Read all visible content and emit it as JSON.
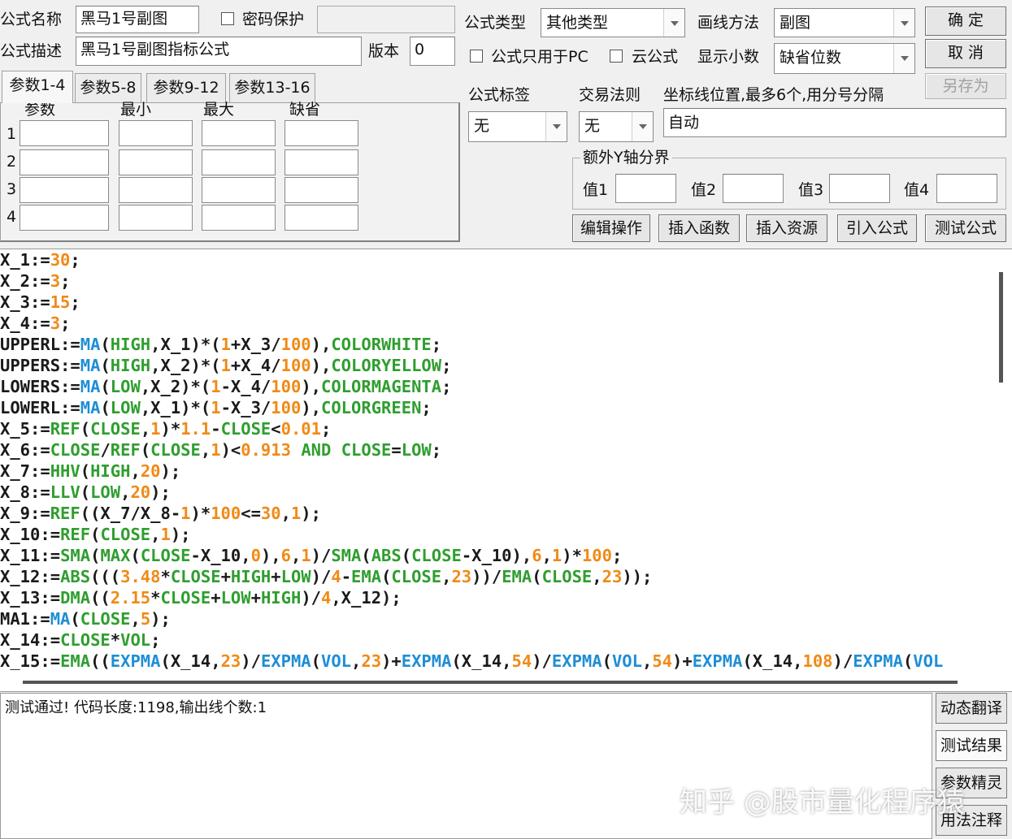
{
  "top": {
    "name_label": "公式名称",
    "name_value": "黑马1号副图",
    "password_label": "密码保护",
    "desc_label": "公式描述",
    "desc_value": "黑马1号副图指标公式",
    "version_label": "版本",
    "version_value": "0",
    "type_label": "公式类型",
    "type_value": "其他类型",
    "draw_label": "画线方法",
    "draw_value": "副图",
    "pc_only_label": "公式只用于PC",
    "cloud_label": "云公式",
    "decimals_label": "显示小数",
    "decimals_value": "缺省位数",
    "ok_button": "确  定",
    "cancel_button": "取  消",
    "save_as_button": "另存为"
  },
  "params": {
    "tabs": [
      "参数1-4",
      "参数5-8",
      "参数9-12",
      "参数13-16"
    ],
    "headers": [
      "参数",
      "最小",
      "最大",
      "缺省"
    ],
    "rows": [
      "1",
      "2",
      "3",
      "4"
    ]
  },
  "options": {
    "tag_label": "公式标签",
    "tag_value": "无",
    "rule_label": "交易法则",
    "rule_value": "无",
    "axis_label": "坐标线位置,最多6个,用分号分隔",
    "axis_value": "自动",
    "extra_y_label": "额外Y轴分界",
    "values": [
      "值1",
      "值2",
      "值3",
      "值4"
    ]
  },
  "actions": [
    "编辑操作",
    "插入函数",
    "插入资源",
    "引入公式",
    "测试公式"
  ],
  "code_lines": [
    [
      [
        "X_1:=",
        "p"
      ],
      [
        "30",
        "n"
      ],
      [
        ";",
        "p"
      ]
    ],
    [
      [
        "X_2:=",
        "p"
      ],
      [
        "3",
        "n"
      ],
      [
        ";",
        "p"
      ]
    ],
    [
      [
        "X_3:=",
        "p"
      ],
      [
        "15",
        "n"
      ],
      [
        ";",
        "p"
      ]
    ],
    [
      [
        "X_4:=",
        "p"
      ],
      [
        "3",
        "n"
      ],
      [
        ";",
        "p"
      ]
    ],
    [
      [
        "UPPERL:=",
        "p"
      ],
      [
        "MA",
        "f"
      ],
      [
        "(",
        "p"
      ],
      [
        "HIGH",
        "k"
      ],
      [
        ",X_1)*(",
        "p"
      ],
      [
        "1",
        "n"
      ],
      [
        "+X_3/",
        "p"
      ],
      [
        "100",
        "n"
      ],
      [
        "),",
        "p"
      ],
      [
        "COLORWHITE",
        "k"
      ],
      [
        ";",
        "p"
      ]
    ],
    [
      [
        "UPPERS:=",
        "p"
      ],
      [
        "MA",
        "f"
      ],
      [
        "(",
        "p"
      ],
      [
        "HIGH",
        "k"
      ],
      [
        ",X_2)*(",
        "p"
      ],
      [
        "1",
        "n"
      ],
      [
        "+X_4/",
        "p"
      ],
      [
        "100",
        "n"
      ],
      [
        "),",
        "p"
      ],
      [
        "COLORYELLOW",
        "k"
      ],
      [
        ";",
        "p"
      ]
    ],
    [
      [
        "LOWERS:=",
        "p"
      ],
      [
        "MA",
        "f"
      ],
      [
        "(",
        "p"
      ],
      [
        "LOW",
        "k"
      ],
      [
        ",X_2)*(",
        "p"
      ],
      [
        "1",
        "n"
      ],
      [
        "-X_4/",
        "p"
      ],
      [
        "100",
        "n"
      ],
      [
        "),",
        "p"
      ],
      [
        "COLORMAGENTA",
        "k"
      ],
      [
        ";",
        "p"
      ]
    ],
    [
      [
        "LOWERL:=",
        "p"
      ],
      [
        "MA",
        "f"
      ],
      [
        "(",
        "p"
      ],
      [
        "LOW",
        "k"
      ],
      [
        ",X_1)*(",
        "p"
      ],
      [
        "1",
        "n"
      ],
      [
        "-X_3/",
        "p"
      ],
      [
        "100",
        "n"
      ],
      [
        "),",
        "p"
      ],
      [
        "COLORGREEN",
        "k"
      ],
      [
        ";",
        "p"
      ]
    ],
    [
      [
        "X_5:=",
        "p"
      ],
      [
        "REF",
        "k"
      ],
      [
        "(",
        "p"
      ],
      [
        "CLOSE",
        "k"
      ],
      [
        ",",
        "p"
      ],
      [
        "1",
        "n"
      ],
      [
        ")*",
        "p"
      ],
      [
        "1.1",
        "n"
      ],
      [
        "-",
        "p"
      ],
      [
        "CLOSE",
        "k"
      ],
      [
        "<",
        "p"
      ],
      [
        "0.01",
        "n"
      ],
      [
        ";",
        "p"
      ]
    ],
    [
      [
        "X_6:=",
        "p"
      ],
      [
        "CLOSE",
        "k"
      ],
      [
        "/",
        "p"
      ],
      [
        "REF",
        "k"
      ],
      [
        "(",
        "p"
      ],
      [
        "CLOSE",
        "k"
      ],
      [
        ",",
        "p"
      ],
      [
        "1",
        "n"
      ],
      [
        ")<",
        "p"
      ],
      [
        "0.913",
        "n"
      ],
      [
        " ",
        "p"
      ],
      [
        "AND",
        "k"
      ],
      [
        " ",
        "p"
      ],
      [
        "CLOSE",
        "k"
      ],
      [
        "=",
        "p"
      ],
      [
        "LOW",
        "k"
      ],
      [
        ";",
        "p"
      ]
    ],
    [
      [
        "X_7:=",
        "p"
      ],
      [
        "HHV",
        "k"
      ],
      [
        "(",
        "p"
      ],
      [
        "HIGH",
        "k"
      ],
      [
        ",",
        "p"
      ],
      [
        "20",
        "n"
      ],
      [
        ");",
        "p"
      ]
    ],
    [
      [
        "X_8:=",
        "p"
      ],
      [
        "LLV",
        "k"
      ],
      [
        "(",
        "p"
      ],
      [
        "LOW",
        "k"
      ],
      [
        ",",
        "p"
      ],
      [
        "20",
        "n"
      ],
      [
        ");",
        "p"
      ]
    ],
    [
      [
        "X_9:=",
        "p"
      ],
      [
        "REF",
        "k"
      ],
      [
        "((X_7/X_8-",
        "p"
      ],
      [
        "1",
        "n"
      ],
      [
        ")*",
        "p"
      ],
      [
        "100",
        "n"
      ],
      [
        "<=",
        "p"
      ],
      [
        "30",
        "n"
      ],
      [
        ",",
        "p"
      ],
      [
        "1",
        "n"
      ],
      [
        ");",
        "p"
      ]
    ],
    [
      [
        "X_10:=",
        "p"
      ],
      [
        "REF",
        "k"
      ],
      [
        "(",
        "p"
      ],
      [
        "CLOSE",
        "k"
      ],
      [
        ",",
        "p"
      ],
      [
        "1",
        "n"
      ],
      [
        ");",
        "p"
      ]
    ],
    [
      [
        "X_11:=",
        "p"
      ],
      [
        "SMA",
        "k"
      ],
      [
        "(",
        "p"
      ],
      [
        "MAX",
        "k"
      ],
      [
        "(",
        "p"
      ],
      [
        "CLOSE",
        "k"
      ],
      [
        "-X_10,",
        "p"
      ],
      [
        "0",
        "n"
      ],
      [
        "),",
        "p"
      ],
      [
        "6",
        "n"
      ],
      [
        ",",
        "p"
      ],
      [
        "1",
        "n"
      ],
      [
        ")/",
        "p"
      ],
      [
        "SMA",
        "k"
      ],
      [
        "(",
        "p"
      ],
      [
        "ABS",
        "k"
      ],
      [
        "(",
        "p"
      ],
      [
        "CLOSE",
        "k"
      ],
      [
        "-X_10),",
        "p"
      ],
      [
        "6",
        "n"
      ],
      [
        ",",
        "p"
      ],
      [
        "1",
        "n"
      ],
      [
        ")*",
        "p"
      ],
      [
        "100",
        "n"
      ],
      [
        ";",
        "p"
      ]
    ],
    [
      [
        "X_12:=",
        "p"
      ],
      [
        "ABS",
        "k"
      ],
      [
        "(((",
        "p"
      ],
      [
        "3.48",
        "n"
      ],
      [
        "*",
        "p"
      ],
      [
        "CLOSE",
        "k"
      ],
      [
        "+",
        "p"
      ],
      [
        "HIGH",
        "k"
      ],
      [
        "+",
        "p"
      ],
      [
        "LOW",
        "k"
      ],
      [
        ")/",
        "p"
      ],
      [
        "4",
        "n"
      ],
      [
        "-",
        "p"
      ],
      [
        "EMA",
        "k"
      ],
      [
        "(",
        "p"
      ],
      [
        "CLOSE",
        "k"
      ],
      [
        ",",
        "p"
      ],
      [
        "23",
        "n"
      ],
      [
        "))/",
        "p"
      ],
      [
        "EMA",
        "k"
      ],
      [
        "(",
        "p"
      ],
      [
        "CLOSE",
        "k"
      ],
      [
        ",",
        "p"
      ],
      [
        "23",
        "n"
      ],
      [
        "));",
        "p"
      ]
    ],
    [
      [
        "X_13:=",
        "p"
      ],
      [
        "DMA",
        "k"
      ],
      [
        "((",
        "p"
      ],
      [
        "2.15",
        "n"
      ],
      [
        "*",
        "p"
      ],
      [
        "CLOSE",
        "k"
      ],
      [
        "+",
        "p"
      ],
      [
        "LOW",
        "k"
      ],
      [
        "+",
        "p"
      ],
      [
        "HIGH",
        "k"
      ],
      [
        ")/",
        "p"
      ],
      [
        "4",
        "n"
      ],
      [
        ",X_12);",
        "p"
      ]
    ],
    [
      [
        "MA1:=",
        "p"
      ],
      [
        "MA",
        "f"
      ],
      [
        "(",
        "p"
      ],
      [
        "CLOSE",
        "k"
      ],
      [
        ",",
        "p"
      ],
      [
        "5",
        "n"
      ],
      [
        ");",
        "p"
      ]
    ],
    [
      [
        "X_14:=",
        "p"
      ],
      [
        "CLOSE",
        "k"
      ],
      [
        "*",
        "p"
      ],
      [
        "VOL",
        "k"
      ],
      [
        ";",
        "p"
      ]
    ],
    [
      [
        "X_15:=",
        "p"
      ],
      [
        "EMA",
        "k"
      ],
      [
        "((",
        "p"
      ],
      [
        "EXPMA",
        "f"
      ],
      [
        "(X_14,",
        "p"
      ],
      [
        "23",
        "n"
      ],
      [
        ")/",
        "p"
      ],
      [
        "EXPMA",
        "f"
      ],
      [
        "(",
        "p"
      ],
      [
        "VOL",
        "f"
      ],
      [
        ",",
        "p"
      ],
      [
        "23",
        "n"
      ],
      [
        ")+",
        "p"
      ],
      [
        "EXPMA",
        "f"
      ],
      [
        "(X_14,",
        "p"
      ],
      [
        "54",
        "n"
      ],
      [
        ")/",
        "p"
      ],
      [
        "EXPMA",
        "f"
      ],
      [
        "(",
        "p"
      ],
      [
        "VOL",
        "f"
      ],
      [
        ",",
        "p"
      ],
      [
        "54",
        "n"
      ],
      [
        ")+",
        "p"
      ],
      [
        "EXPMA",
        "f"
      ],
      [
        "(X_14,",
        "p"
      ],
      [
        "108",
        "n"
      ],
      [
        ")/",
        "p"
      ],
      [
        "EXPMA",
        "f"
      ],
      [
        "(",
        "p"
      ],
      [
        "VOL",
        "f"
      ],
      [
        "",
        "p"
      ]
    ]
  ],
  "result_text": "测试通过! 代码长度:1198,输出线个数:1",
  "side_buttons": [
    "动态翻译",
    "测试结果",
    "参数精灵",
    "用法注释"
  ],
  "watermark": "知乎 @股市量化程序猿"
}
